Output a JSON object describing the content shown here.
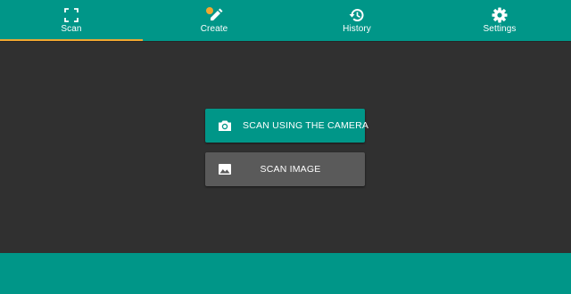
{
  "colors": {
    "primary": "#009688",
    "accent": "#f0a830",
    "background": "#303030",
    "secondary_button": "#5a5a5a"
  },
  "nav": {
    "active_tab": "Scan",
    "tabs": [
      {
        "label": "Scan",
        "icon": "scan-frame-icon"
      },
      {
        "label": "Create",
        "icon": "pencil-icon"
      },
      {
        "label": "History",
        "icon": "history-icon"
      },
      {
        "label": "Settings",
        "icon": "gear-icon"
      }
    ]
  },
  "main": {
    "scan_camera_label": "SCAN USING THE CAMERA",
    "scan_camera_icon": "camera-icon",
    "scan_image_label": "SCAN IMAGE",
    "scan_image_icon": "image-icon"
  }
}
